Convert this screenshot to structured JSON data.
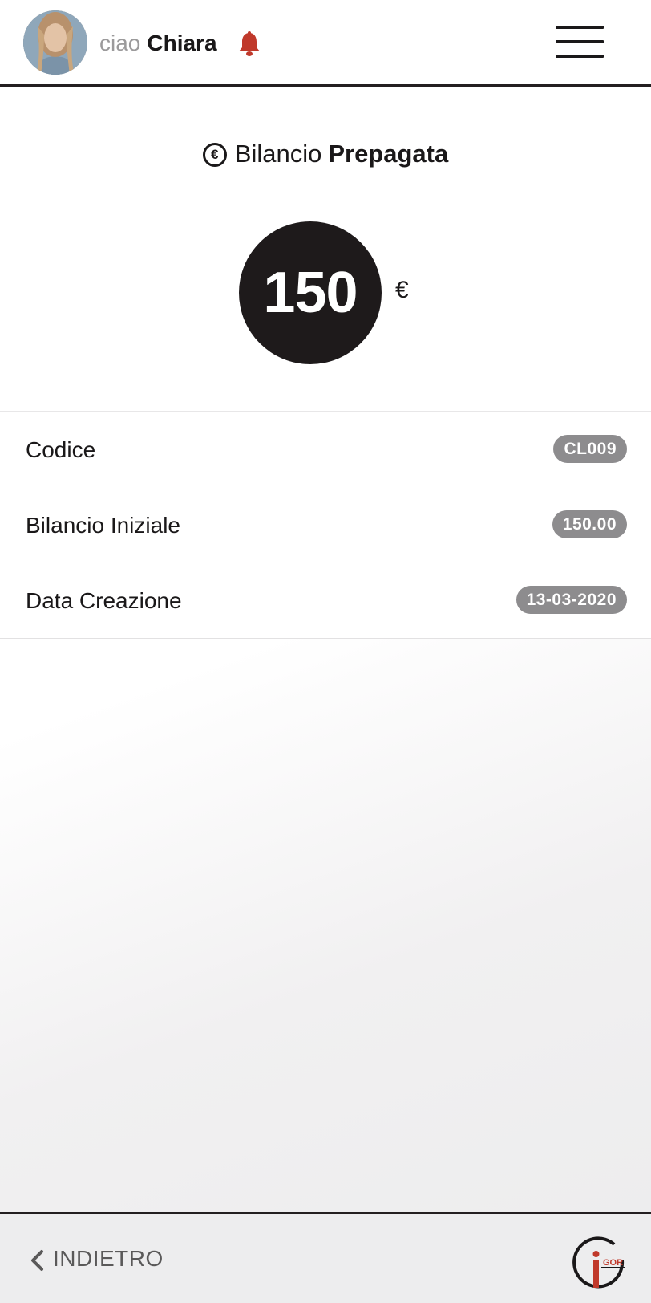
{
  "header": {
    "greeting": "ciao",
    "user_name": "Chiara",
    "notification_color": "#c0392b"
  },
  "balance": {
    "title_light": "Bilancio",
    "title_bold": "Prepagata",
    "amount": "150",
    "currency": "€"
  },
  "details": [
    {
      "label": "Codice",
      "value": "CL009"
    },
    {
      "label": "Bilancio Iniziale",
      "value": "150.00"
    },
    {
      "label": "Data Creazione",
      "value": "13-03-2020"
    }
  ],
  "footer": {
    "back_label": "INDIETRO",
    "logo_text": "GOR"
  },
  "colors": {
    "accent_red": "#c0392b",
    "dark": "#1e1a1b",
    "badge": "#8d8c8e"
  }
}
